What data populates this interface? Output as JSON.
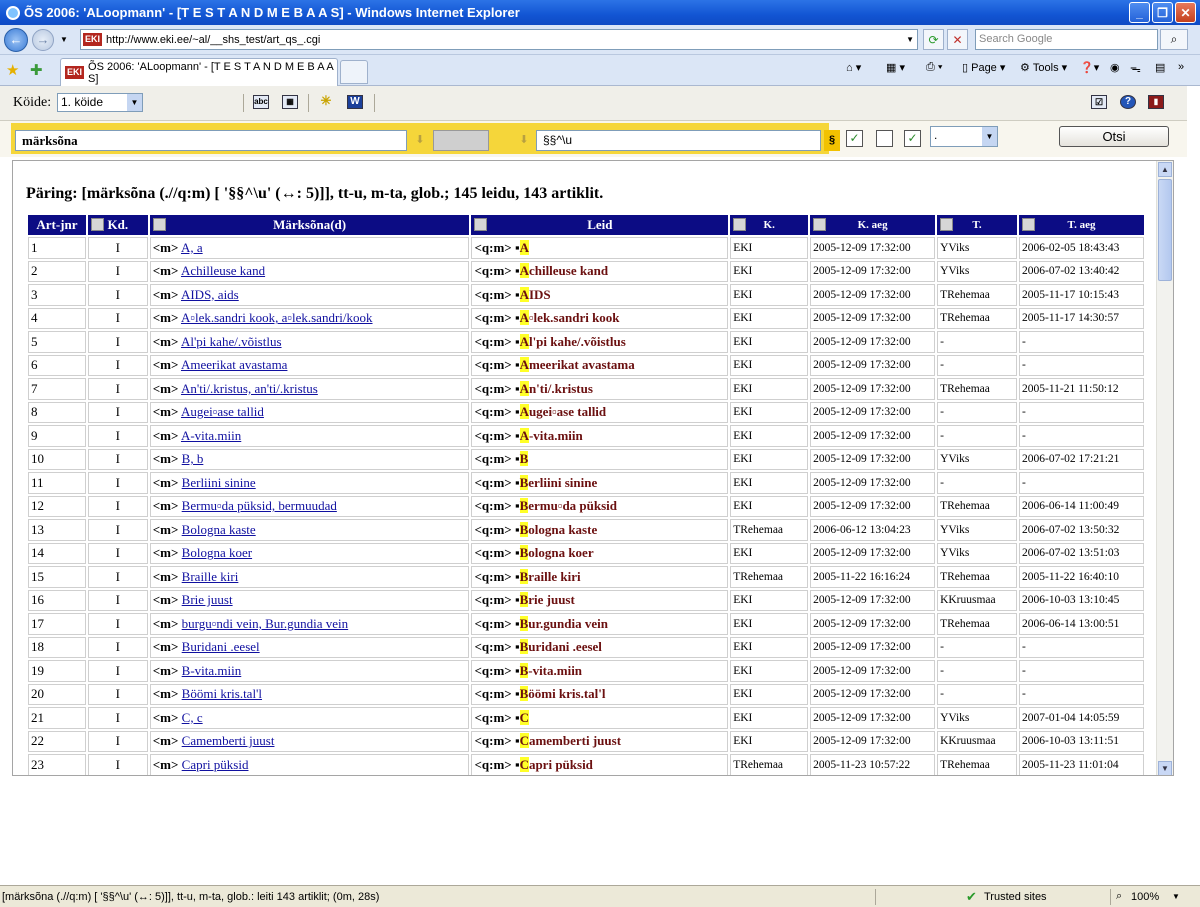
{
  "window": {
    "title": "ÕS 2006: 'ALoopmann' - [T E S T A N D M E B A A S] - Windows Internet Explorer"
  },
  "address": {
    "url": "http://www.eki.ee/~al/__shs_test/art_qs_.cgi",
    "logo": "EKI"
  },
  "search": {
    "placeholder": "Search Google"
  },
  "tab": {
    "label": "ÕS 2006: 'ALoopmann' - [T E S T A N D M E B A A S]"
  },
  "commands": {
    "page": "Page",
    "tools": "Tools"
  },
  "toolbar": {
    "koide_label": "Köide:",
    "koide_value": "1. köide"
  },
  "query": {
    "field": "märksõna",
    "pattern": "§§^\\u",
    "section": "§",
    "select_value": ".",
    "otsi_label": "Otsi"
  },
  "summary": "Päring: [märksõna (.//q:m) [ '§§^\\u' (↔: 5)]], tt-u, m-ta, glob.; 145 leidu, 143 artiklit.",
  "table": {
    "headers": [
      "Art-jnr",
      "Kd.",
      "Märksõna(d)",
      "Leid",
      "K.",
      "K. aeg",
      "T.",
      "T. aeg"
    ],
    "rows": [
      {
        "n": "1",
        "kd": "I",
        "tag": "<m>",
        "mark": "A, a",
        "lq": "<q:m>",
        "lhl": "A",
        "lrest": "",
        "k": "EKI",
        "kaeg": "2005-12-09 17:32:00",
        "t": "YViks",
        "taeg": "2006-02-05 18:43:43"
      },
      {
        "n": "2",
        "kd": "I",
        "tag": "<m>",
        "mark": "Achilleuse kand",
        "lq": "<q:m>",
        "lhl": "A",
        "lrest": "chilleuse kand",
        "k": "EKI",
        "kaeg": "2005-12-09 17:32:00",
        "t": "YViks",
        "taeg": "2006-07-02 13:40:42"
      },
      {
        "n": "3",
        "kd": "I",
        "tag": "<m>",
        "mark": "AIDS, aids",
        "lq": "<q:m>",
        "lhl": "A",
        "lrest": "IDS",
        "k": "EKI",
        "kaeg": "2005-12-09 17:32:00",
        "t": "TRehemaa",
        "taeg": "2005-11-17 10:15:43"
      },
      {
        "n": "4",
        "kd": "I",
        "tag": "<m>",
        "mark": "A▫lek.sandri kook, a▫lek.sandri/kook",
        "lq": "<q:m>",
        "lhl": "A",
        "lrest": "▫lek.sandri kook",
        "k": "EKI",
        "kaeg": "2005-12-09 17:32:00",
        "t": "TRehemaa",
        "taeg": "2005-11-17 14:30:57"
      },
      {
        "n": "5",
        "kd": "I",
        "tag": "<m>",
        "mark": "Al'pi kahe/.võistlus",
        "lq": "<q:m>",
        "lhl": "A",
        "lrest": "l'pi kahe/.võistlus",
        "k": "EKI",
        "kaeg": "2005-12-09 17:32:00",
        "t": "-",
        "taeg": "-"
      },
      {
        "n": "6",
        "kd": "I",
        "tag": "<m>",
        "mark": "Ameerikat avastama",
        "lq": "<q:m>",
        "lhl": "A",
        "lrest": "meerikat avastama",
        "k": "EKI",
        "kaeg": "2005-12-09 17:32:00",
        "t": "-",
        "taeg": "-"
      },
      {
        "n": "7",
        "kd": "I",
        "tag": "<m>",
        "mark": "An'ti/.kristus, an'ti/.kristus",
        "lq": "<q:m>",
        "lhl": "A",
        "lrest": "n'ti/.kristus",
        "k": "EKI",
        "kaeg": "2005-12-09 17:32:00",
        "t": "TRehemaa",
        "taeg": "2005-11-21 11:50:12"
      },
      {
        "n": "8",
        "kd": "I",
        "tag": "<m>",
        "mark": "Augei▫ase tallid",
        "lq": "<q:m>",
        "lhl": "A",
        "lrest": "ugei▫ase tallid",
        "k": "EKI",
        "kaeg": "2005-12-09 17:32:00",
        "t": "-",
        "taeg": "-"
      },
      {
        "n": "9",
        "kd": "I",
        "tag": "<m>",
        "mark": "A-vita.miin",
        "lq": "<q:m>",
        "lhl": "A",
        "lrest": "-vita.miin",
        "k": "EKI",
        "kaeg": "2005-12-09 17:32:00",
        "t": "-",
        "taeg": "-"
      },
      {
        "n": "10",
        "kd": "I",
        "tag": "<m>",
        "mark": "B, b",
        "lq": "<q:m>",
        "lhl": "B",
        "lrest": "",
        "k": "EKI",
        "kaeg": "2005-12-09 17:32:00",
        "t": "YViks",
        "taeg": "2006-07-02 17:21:21"
      },
      {
        "n": "11",
        "kd": "I",
        "tag": "<m>",
        "mark": "Berliini sinine",
        "lq": "<q:m>",
        "lhl": "B",
        "lrest": "erliini sinine",
        "k": "EKI",
        "kaeg": "2005-12-09 17:32:00",
        "t": "-",
        "taeg": "-"
      },
      {
        "n": "12",
        "kd": "I",
        "tag": "<m>",
        "mark": "Bermu▫da püksid, bermuudad",
        "lq": "<q:m>",
        "lhl": "B",
        "lrest": "ermu▫da püksid",
        "k": "EKI",
        "kaeg": "2005-12-09 17:32:00",
        "t": "TRehemaa",
        "taeg": "2006-06-14 11:00:49"
      },
      {
        "n": "13",
        "kd": "I",
        "tag": "<m>",
        "mark": "Bologna kaste",
        "lq": "<q:m>",
        "lhl": "B",
        "lrest": "ologna kaste",
        "k": "TRehemaa",
        "kaeg": "2006-06-12 13:04:23",
        "t": "YViks",
        "taeg": "2006-07-02 13:50:32"
      },
      {
        "n": "14",
        "kd": "I",
        "tag": "<m>",
        "mark": "Bologna koer",
        "lq": "<q:m>",
        "lhl": "B",
        "lrest": "ologna koer",
        "k": "EKI",
        "kaeg": "2005-12-09 17:32:00",
        "t": "YViks",
        "taeg": "2006-07-02 13:51:03"
      },
      {
        "n": "15",
        "kd": "I",
        "tag": "<m>",
        "mark": "Braille kiri",
        "lq": "<q:m>",
        "lhl": "B",
        "lrest": "raille kiri",
        "k": "TRehemaa",
        "kaeg": "2005-11-22 16:16:24",
        "t": "TRehemaa",
        "taeg": "2005-11-22 16:40:10"
      },
      {
        "n": "16",
        "kd": "I",
        "tag": "<m>",
        "mark": "Brie juust",
        "lq": "<q:m>",
        "lhl": "B",
        "lrest": "rie juust",
        "k": "EKI",
        "kaeg": "2005-12-09 17:32:00",
        "t": "KKruusmaa",
        "taeg": "2006-10-03 13:10:45"
      },
      {
        "n": "17",
        "kd": "I",
        "tag": "<m>",
        "mark": "burgu▫ndi vein, Bur.gundia vein",
        "lq": "<q:m>",
        "lhl": "B",
        "lrest": "ur.gundia vein",
        "k": "EKI",
        "kaeg": "2005-12-09 17:32:00",
        "t": "TRehemaa",
        "taeg": "2006-06-14 13:00:51"
      },
      {
        "n": "18",
        "kd": "I",
        "tag": "<m>",
        "mark": "Buridani .eesel",
        "lq": "<q:m>",
        "lhl": "B",
        "lrest": "uridani .eesel",
        "k": "EKI",
        "kaeg": "2005-12-09 17:32:00",
        "t": "-",
        "taeg": "-"
      },
      {
        "n": "19",
        "kd": "I",
        "tag": "<m>",
        "mark": "B-vita.miin",
        "lq": "<q:m>",
        "lhl": "B",
        "lrest": "-vita.miin",
        "k": "EKI",
        "kaeg": "2005-12-09 17:32:00",
        "t": "-",
        "taeg": "-"
      },
      {
        "n": "20",
        "kd": "I",
        "tag": "<m>",
        "mark": "Böömi kris.tal'l",
        "lq": "<q:m>",
        "lhl": "B",
        "lrest": "öömi kris.tal'l",
        "k": "EKI",
        "kaeg": "2005-12-09 17:32:00",
        "t": "-",
        "taeg": "-"
      },
      {
        "n": "21",
        "kd": "I",
        "tag": "<m>",
        "mark": "C, c",
        "lq": "<q:m>",
        "lhl": "C",
        "lrest": "",
        "k": "EKI",
        "kaeg": "2005-12-09 17:32:00",
        "t": "YViks",
        "taeg": "2007-01-04 14:05:59"
      },
      {
        "n": "22",
        "kd": "I",
        "tag": "<m>",
        "mark": "Camemberti juust",
        "lq": "<q:m>",
        "lhl": "C",
        "lrest": "amemberti juust",
        "k": "EKI",
        "kaeg": "2005-12-09 17:32:00",
        "t": "KKruusmaa",
        "taeg": "2006-10-03 13:11:51"
      },
      {
        "n": "23",
        "kd": "I",
        "tag": "<m>",
        "mark": "Capri püksid",
        "lq": "<q:m>",
        "lhl": "C",
        "lrest": "apri püksid",
        "k": "TRehemaa",
        "kaeg": "2005-11-23 10:57:22",
        "t": "TRehemaa",
        "taeg": "2005-11-23 11:01:04"
      }
    ]
  },
  "status": {
    "text": "[märksõna (.//q:m) [ '§§^\\u' (↔: 5)]], tt-u, m-ta, glob.: leiti 143 artiklit; (0m, 28s)",
    "zone": "Trusted sites",
    "zoom": "100%"
  },
  "colors": {
    "titlebar": "#1255d3",
    "header_bg": "#0c0c84",
    "query_bar": "#f5d63a",
    "highlight": "#ffff28",
    "leid_text": "#6b1010"
  }
}
